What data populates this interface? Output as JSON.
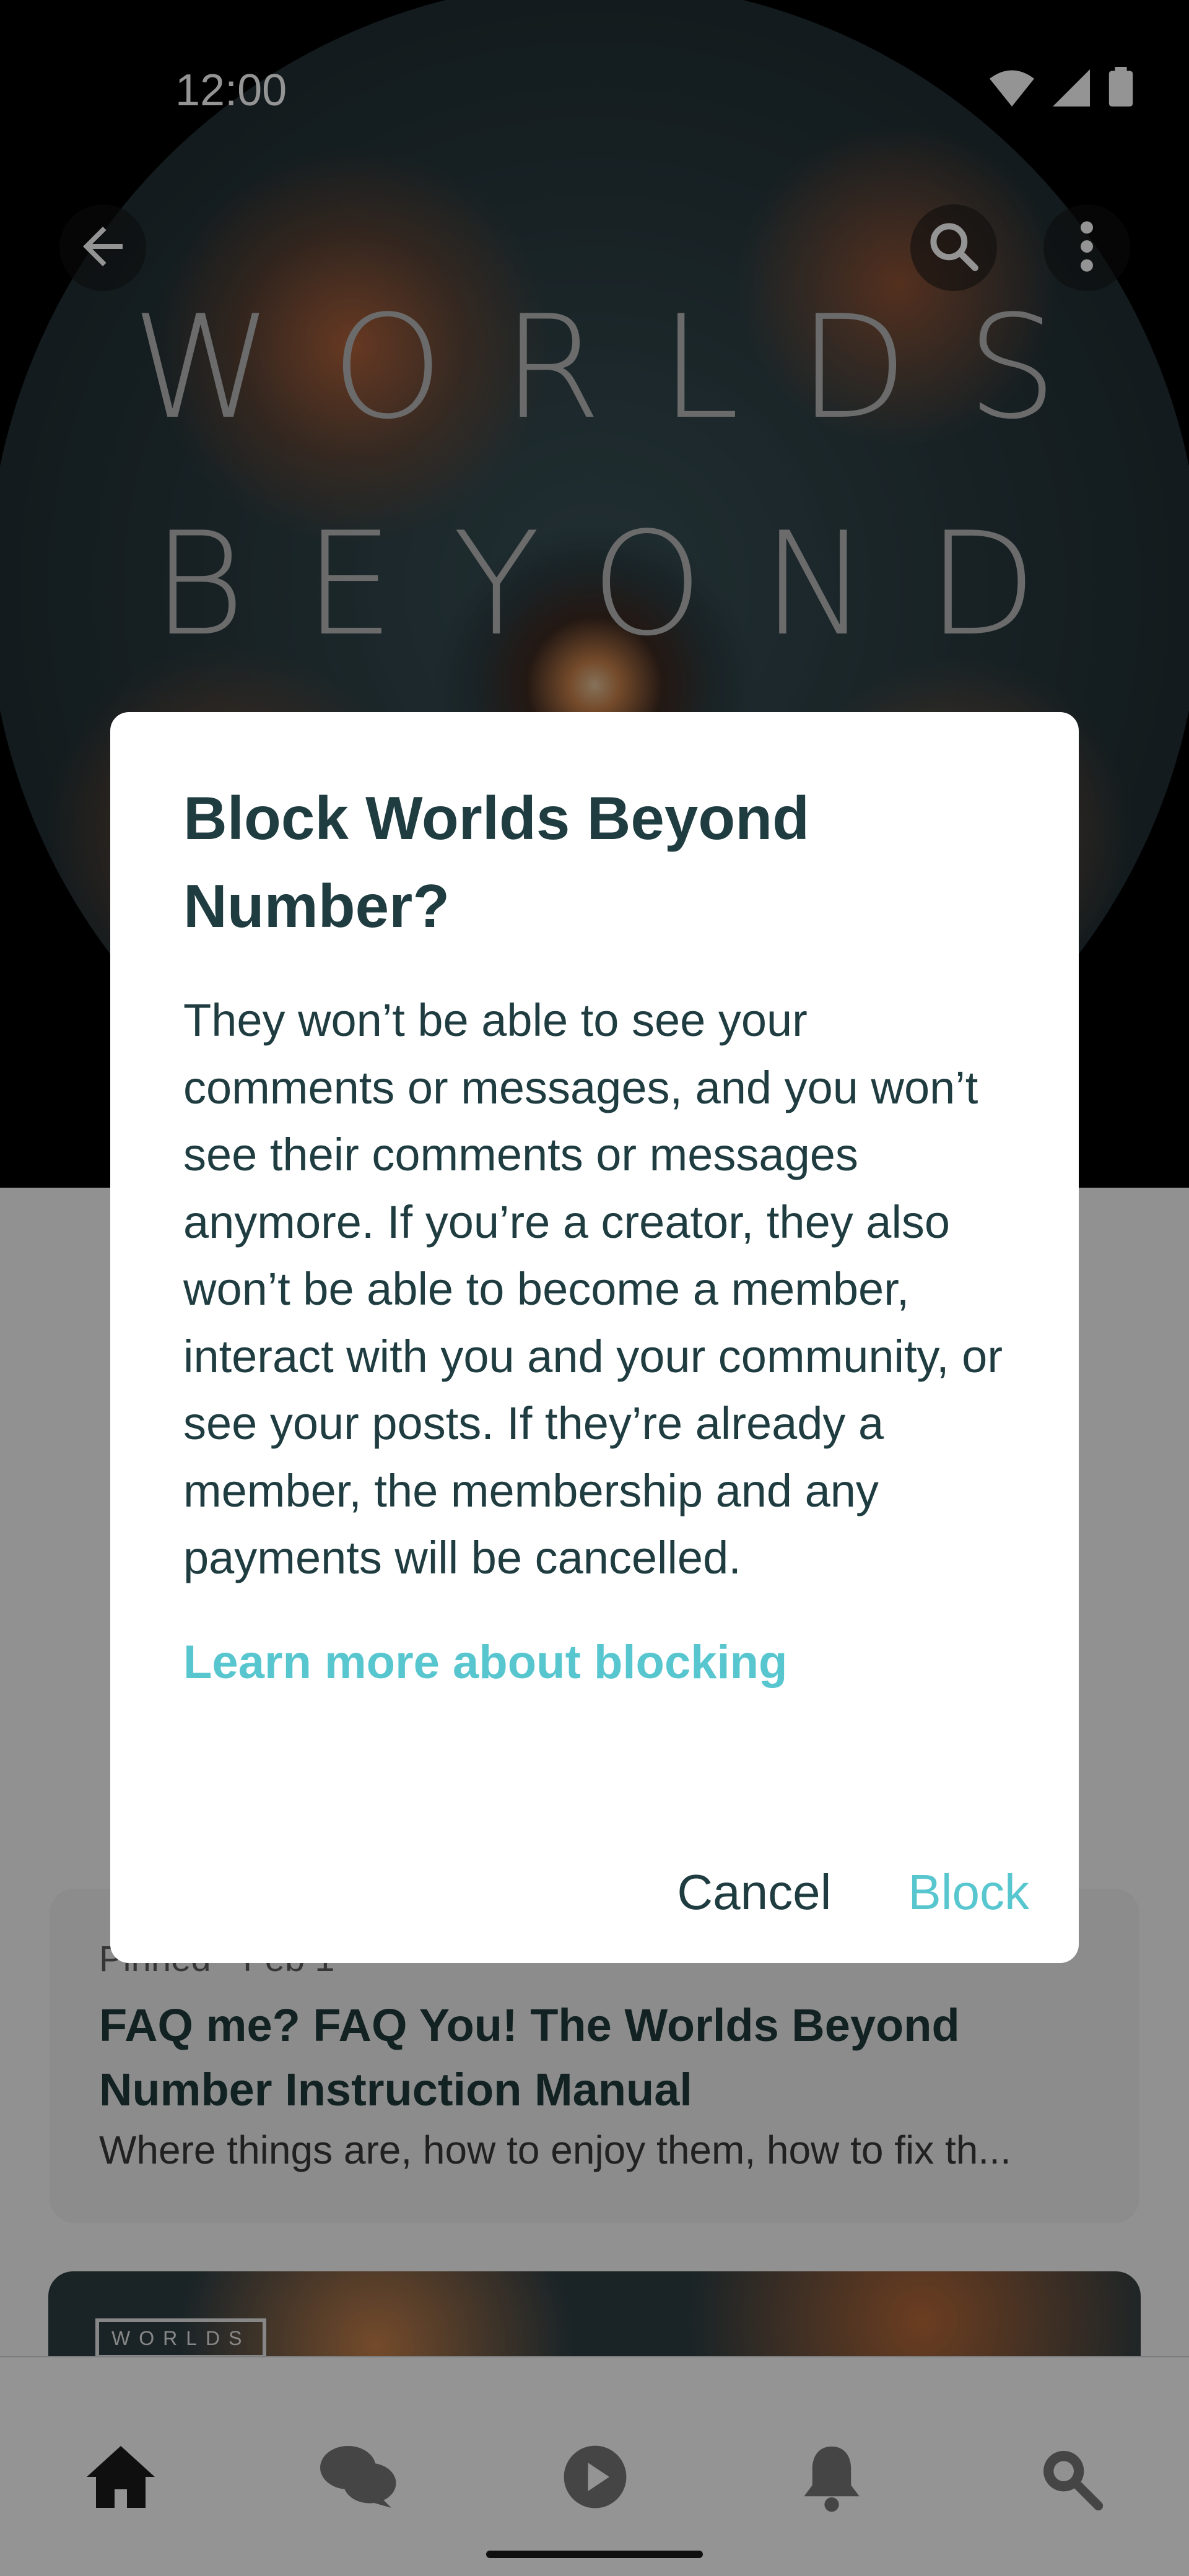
{
  "status_bar": {
    "time": "12:00"
  },
  "hero": {
    "title_line1": "WORLDS",
    "title_line2": "BEYOND"
  },
  "pinned_post": {
    "meta": "Pinned · Feb 1",
    "title": "FAQ me? FAQ You! The Worlds Beyond Number Instruction Manual",
    "description": "Where things are, how to enjoy them, how to fix th..."
  },
  "post_card": {
    "logo_text": "WORLDS"
  },
  "dialog": {
    "title": "Block Worlds Beyond Number?",
    "body": "They won’t be able to see your comments or messages, and you won’t see their comments or messages anymore. If you’re a creator, they also won’t be able to become a member, interact with you and your community, or see your posts. If they’re already a member, the membership and any payments will be cancelled.",
    "learn_more": "Learn more about blocking",
    "cancel_label": "Cancel",
    "block_label": "Block"
  },
  "bottom_nav": {
    "items": [
      "home-icon",
      "chat-icon",
      "play-icon",
      "bell-icon",
      "search-icon"
    ]
  },
  "colors": {
    "accent": "#58c6cf",
    "text_dark": "#1f3c40"
  }
}
